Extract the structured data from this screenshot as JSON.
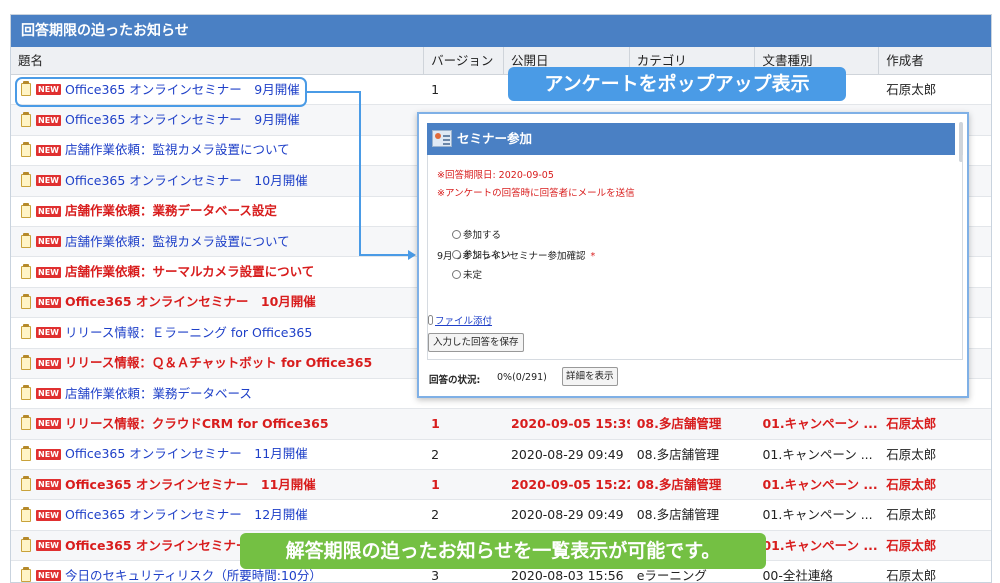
{
  "panel": {
    "title": "回答期限の迫ったお知らせ"
  },
  "columns": [
    "題名",
    "バージョン",
    "公開日",
    "カテゴリ",
    "文書種別",
    "作成者"
  ],
  "badge_new": "NEW",
  "rows": [
    {
      "title": "Office365 オンラインセミナー　9月開催",
      "version": "1",
      "date": "",
      "category": "",
      "doctype": "ン ...",
      "author": "石原太郎",
      "urgent": false
    },
    {
      "title": "Office365 オンラインセミナー　9月開催",
      "version": "",
      "date": "",
      "category": "",
      "doctype": "",
      "author": "",
      "urgent": false
    },
    {
      "title": "店舗作業依頼：監視カメラ設置について",
      "version": "",
      "date": "",
      "category": "",
      "doctype": "",
      "author": "",
      "urgent": false
    },
    {
      "title": "Office365 オンラインセミナー　10月開催",
      "version": "",
      "date": "",
      "category": "",
      "doctype": "",
      "author": "",
      "urgent": false
    },
    {
      "title": "店舗作業依頼：業務データベース設定",
      "version": "",
      "date": "",
      "category": "",
      "doctype": "",
      "author": "",
      "urgent": true
    },
    {
      "title": "店舗作業依頼：監視カメラ設置について",
      "version": "",
      "date": "",
      "category": "",
      "doctype": "",
      "author": "",
      "urgent": false
    },
    {
      "title": "店舗作業依頼：サーマルカメラ設置について",
      "version": "",
      "date": "",
      "category": "",
      "doctype": "",
      "author": "",
      "urgent": true
    },
    {
      "title": "Office365 オンラインセミナー　10月開催",
      "version": "",
      "date": "",
      "category": "",
      "doctype": "",
      "author": "",
      "urgent": true
    },
    {
      "title": "リリース情報：Ｅラーニング for Office365",
      "version": "",
      "date": "",
      "category": "",
      "doctype": "",
      "author": "",
      "urgent": false
    },
    {
      "title": "リリース情報：Ｑ＆Ａチャットボット for Office365",
      "version": "",
      "date": "",
      "category": "",
      "doctype": "",
      "author": "",
      "urgent": true
    },
    {
      "title": "店舗作業依頼：業務データベース",
      "version": "",
      "date": "",
      "category": "",
      "doctype": "",
      "author": "",
      "urgent": false
    },
    {
      "title": "リリース情報：クラウドCRM for Office365",
      "version": "1",
      "date": "2020-09-05 15:39",
      "category": "08.多店舗管理",
      "doctype": "01.キャンペーン ...",
      "author": "石原太郎",
      "urgent": true
    },
    {
      "title": "Office365 オンラインセミナー　11月開催",
      "version": "2",
      "date": "2020-08-29 09:49",
      "category": "08.多店舗管理",
      "doctype": "01.キャンペーン ...",
      "author": "石原太郎",
      "urgent": false
    },
    {
      "title": "Office365 オンラインセミナー　11月開催",
      "version": "1",
      "date": "2020-09-05 15:22",
      "category": "08.多店舗管理",
      "doctype": "01.キャンペーン ...",
      "author": "石原太郎",
      "urgent": true
    },
    {
      "title": "Office365 オンラインセミナー　12月開催",
      "version": "2",
      "date": "2020-08-29 09:49",
      "category": "08.多店舗管理",
      "doctype": "01.キャンペーン ...",
      "author": "石原太郎",
      "urgent": false
    },
    {
      "title": "Office365 オンラインセミナー　12月開催",
      "version": "1",
      "date": "",
      "category": "",
      "doctype": "01.キャンペーン ...",
      "author": "石原太郎",
      "urgent": true
    },
    {
      "title": "今日のセキュリティリスク（所要時間:10分）",
      "version": "3",
      "date": "2020-08-03 15:56",
      "category": "eラーニング",
      "doctype": "00-全社連絡",
      "author": "石原太郎",
      "urgent": false
    }
  ],
  "callouts": {
    "popup_label": "アンケートをポップアップ表示",
    "bottom_label": "解答期限の迫ったお知らせを一覧表示が可能です。"
  },
  "popup": {
    "title": "セミナー参加",
    "deadline": "※回答期限日: 2020-09-05",
    "notify": "※アンケートの回答時に回答者にメールを送信",
    "question": "9月のオンラインセミナー参加確認",
    "required_mark": "*",
    "options": [
      "参加する",
      "参加しない",
      "未定"
    ],
    "attach_label": "ファイル添付",
    "save_label": "入力した回答を保存",
    "status_label": "回答の状況:",
    "status_value": "0%(0/291)",
    "detail_label": "詳細を表示"
  }
}
